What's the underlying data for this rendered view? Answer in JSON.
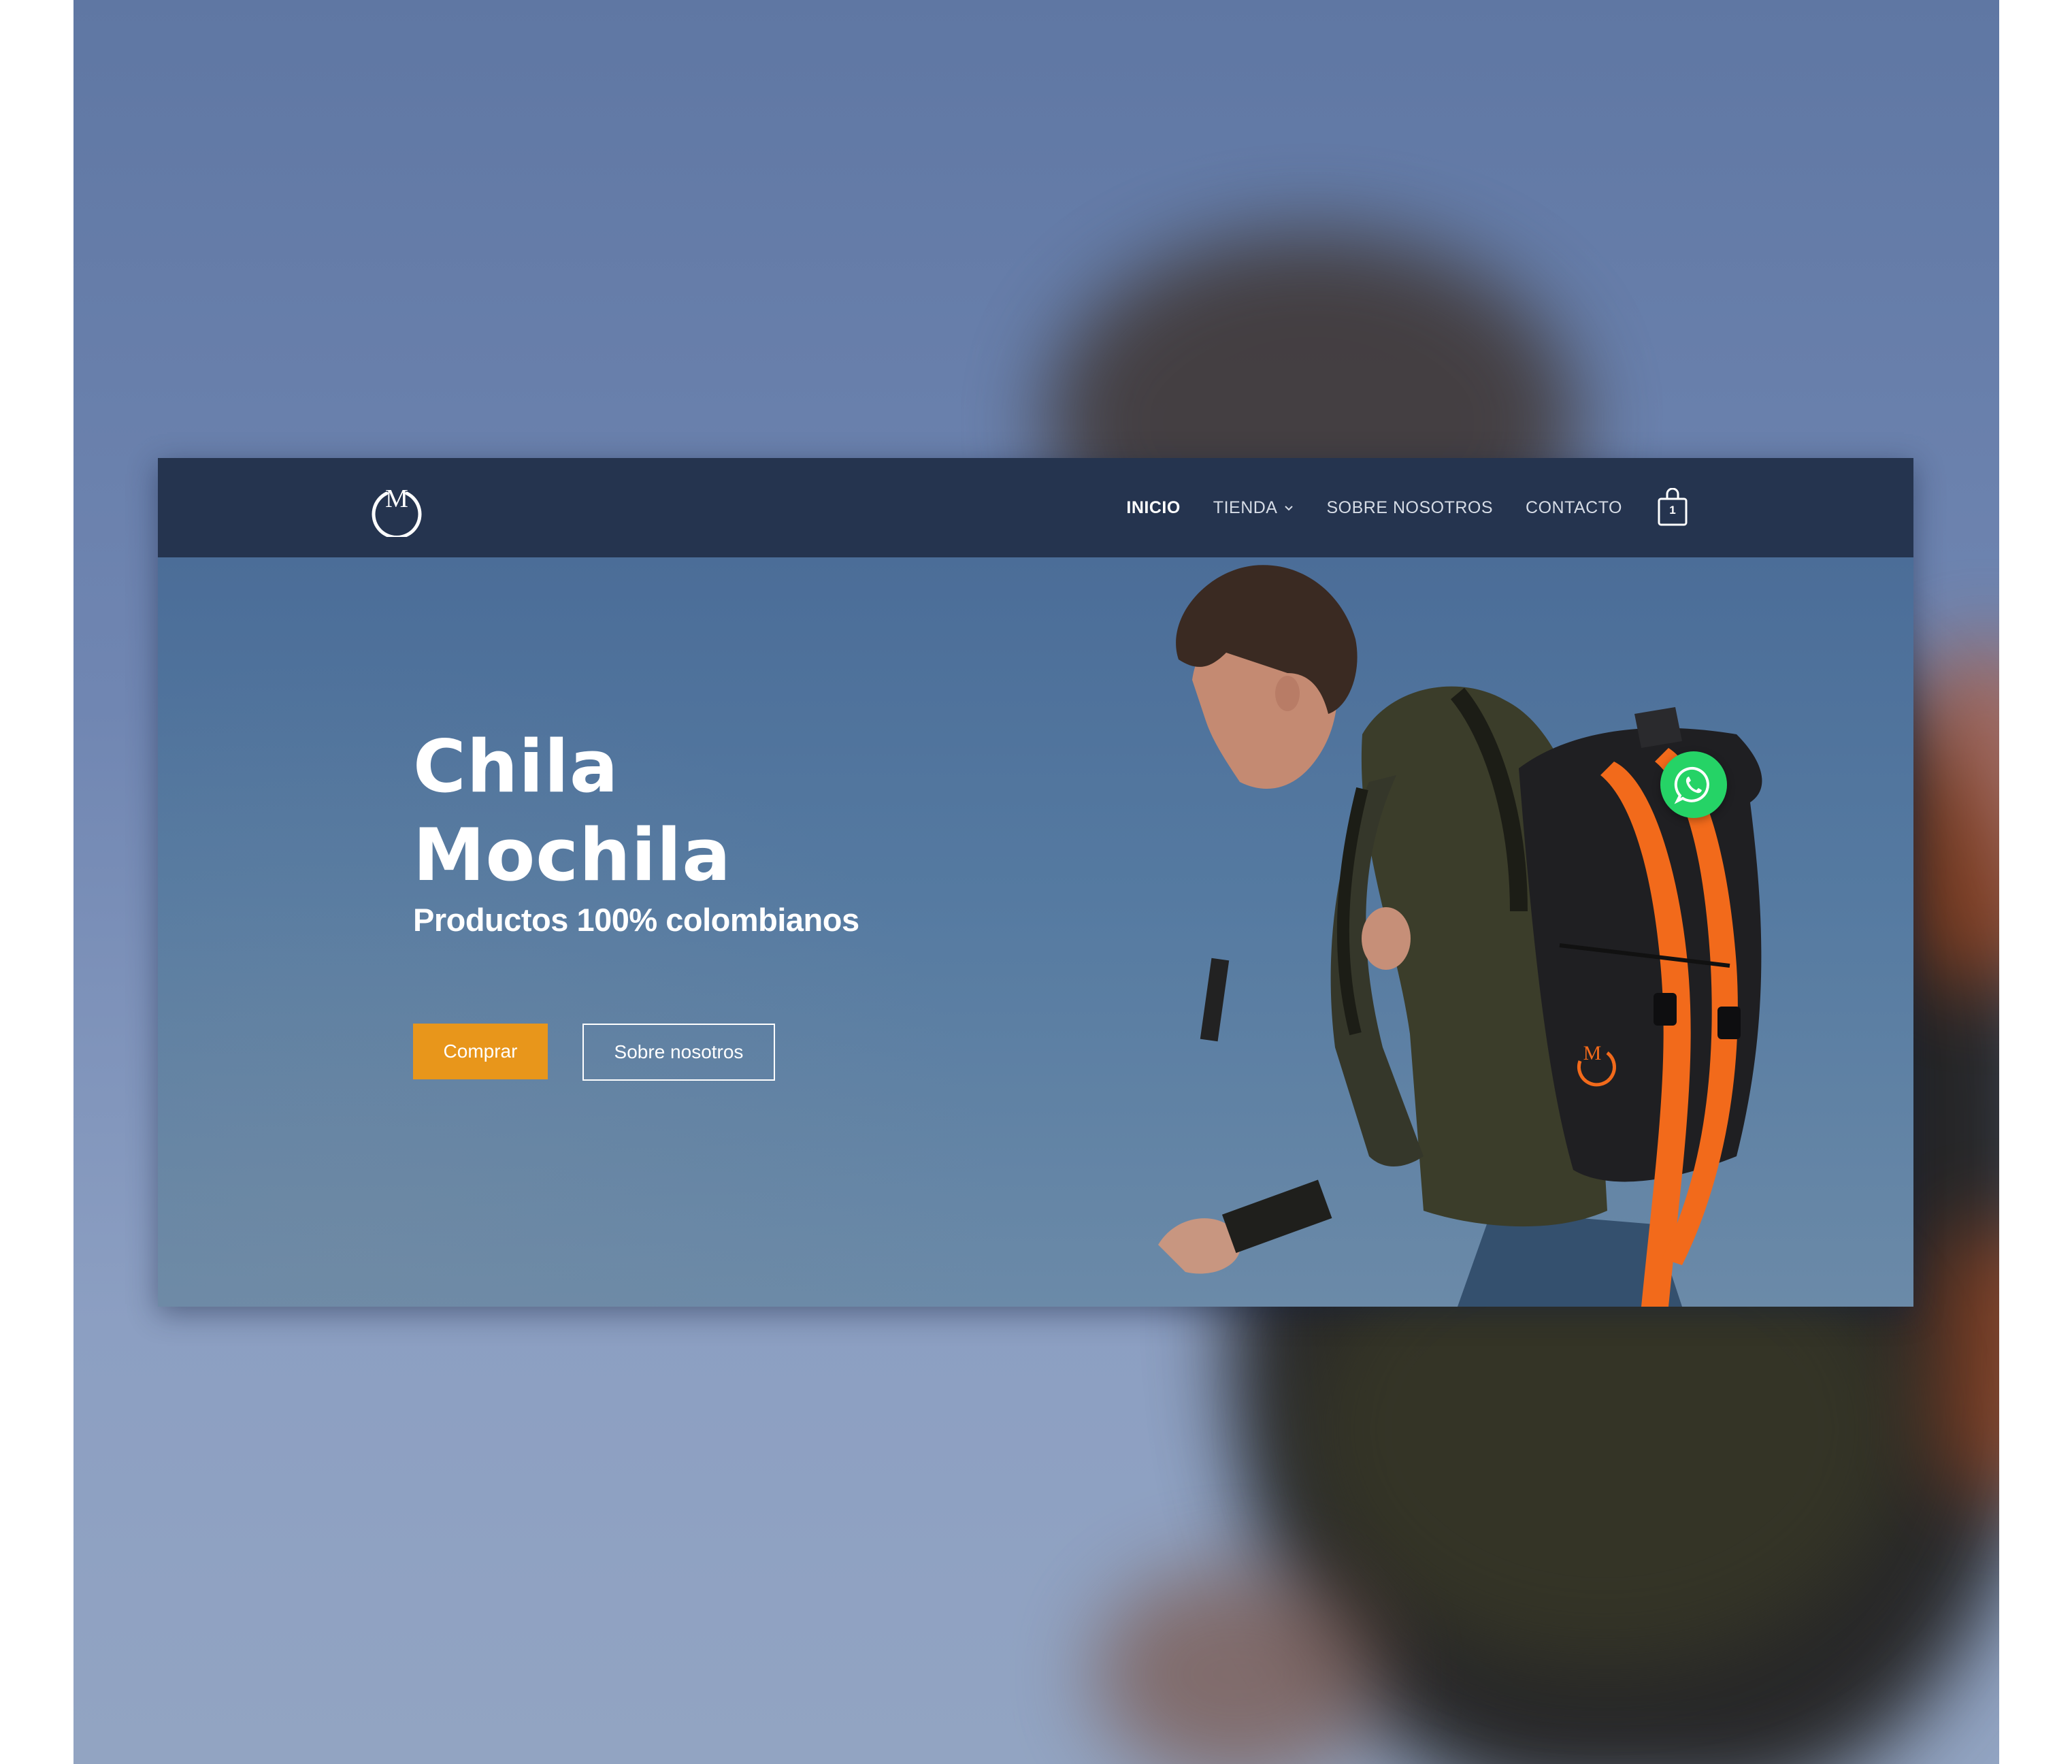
{
  "brand": {
    "logo_icon": "mochila-m-logo-icon",
    "logo_letter": "M"
  },
  "nav": {
    "items": [
      {
        "label": "INICIO",
        "active": true
      },
      {
        "label": "TIENDA",
        "has_dropdown": true
      },
      {
        "label": "SOBRE NOSOTROS"
      },
      {
        "label": "CONTACTO"
      }
    ],
    "cart": {
      "icon": "shopping-bag-icon",
      "count": "1"
    }
  },
  "hero": {
    "title_line1": "Chila",
    "title_line2": "Mochila",
    "subtitle": "Productos 100% colombianos",
    "primary_button": "Comprar",
    "secondary_button": "Sobre nosotros",
    "image": "man-with-black-backpack-orange-straps"
  },
  "floating": {
    "icon": "whatsapp-icon"
  },
  "colors": {
    "navbar": "#25344f",
    "hero_sky": "#557aa1",
    "accent": "#e8961b",
    "whatsapp": "#25d366",
    "backpack_strap": "#f26a1b"
  }
}
